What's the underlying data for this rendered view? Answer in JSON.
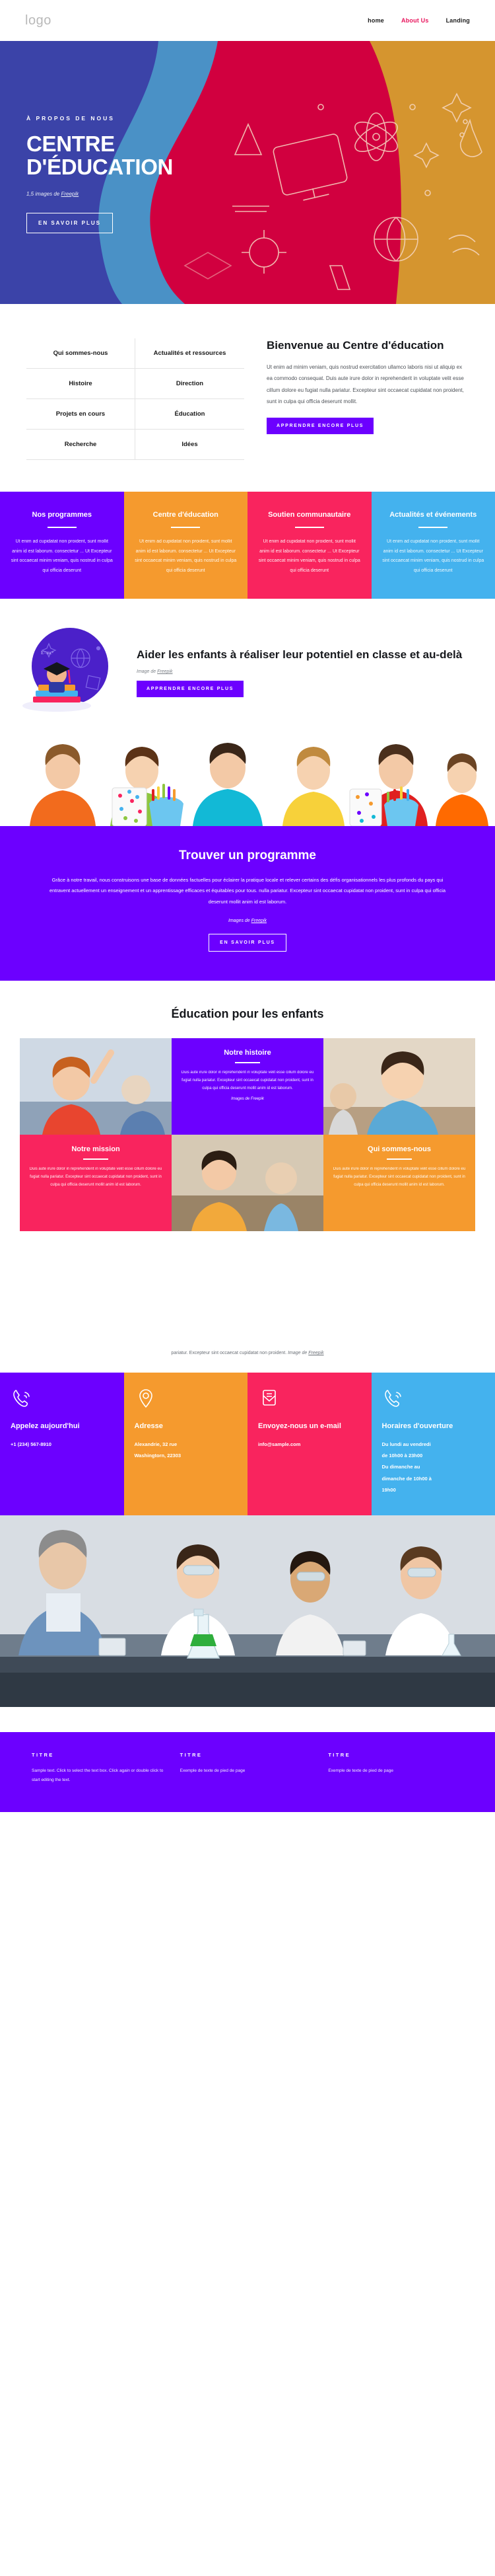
{
  "header": {
    "logo": "logo",
    "nav": [
      {
        "label": "home",
        "active": false
      },
      {
        "label": "About Us",
        "active": true
      },
      {
        "label": "Landing",
        "active": false
      }
    ]
  },
  "hero": {
    "eyebrow": "À PROPOS DE NOUS",
    "title_line1": "CENTRE",
    "title_line2": "D'ÉDUCATION",
    "credit_prefix": "1,5 images de ",
    "credit_link": "Freepik",
    "button": "EN SAVOIR PLUS",
    "colors": {
      "blue_dark": "#3b43a8",
      "blue_light": "#4a91c6",
      "crimson": "#d1003f",
      "orange": "#d5952f"
    }
  },
  "welcome": {
    "menu": [
      "Qui sommes-nous",
      "Actualités et ressources",
      "Histoire",
      "Direction",
      "Projets en cours",
      "Éducation",
      "Recherche",
      "Idées"
    ],
    "heading": "Bienvenue au Centre d'éducation",
    "paragraph": "Ut enim ad minim veniam, quis nostrud exercitation ullamco laboris nisi ut aliquip ex ea commodo consequat. Duis aute irure dolor in reprehenderit in voluptate velit esse cillum dolore eu fugiat nulla pariatur. Excepteur sint occaecat cupidatat non proident, sunt in culpa qui officia deserunt mollit.",
    "button": "APPRENDRE ENCORE PLUS"
  },
  "cards4": {
    "body": "Ut enim ad cupidatat non proident, sunt mollit anim id est laborum. consectetur ... Ut Excepteur sint occaecat minim veniam, quis nostrud in culpa qui officia deserunt",
    "items": [
      {
        "title": "Nos programmes",
        "color": "#6c00ff"
      },
      {
        "title": "Centre d'éducation",
        "color": "#f59a2e"
      },
      {
        "title": "Soutien communautaire",
        "color": "#f9245e"
      },
      {
        "title": "Actualités et événements",
        "color": "#44b2ee"
      }
    ]
  },
  "aider": {
    "heading": "Aider les enfants à réaliser leur potentiel en classe et au-delà",
    "credit_prefix": "Image de ",
    "credit_link": "Freepik",
    "button": "APPRENDRE ENCORE PLUS"
  },
  "trouver": {
    "heading": "Trouver un programme",
    "paragraph": "Grâce à notre travail, nous construisons une base de données factuelles pour éclairer la pratique locale et relever certains des défis organisationnels les plus profonds du pays qui entravent actuellement un enseignement et un apprentissage efficaces et équitables pour tous. nulla pariatur. Excepteur sint occaecat cupidatat non proident, sunt in culpa qui officia deserunt mollit anim id est laborum.",
    "credit_prefix": "Images de ",
    "credit_link": "Freepik",
    "button": "EN SAVOIR PLUS"
  },
  "education": {
    "title": "Éducation pour les enfants",
    "cards": [
      {
        "title": "Notre histoire",
        "color": "#6c00ff",
        "body": "Duis aute irure dolor in reprehenderit in voluptate velit esse cillum dolore eu fugiat nulla pariatur. Excepteur sint occaecat cupidatat non proident, sunt in culpa qui officia deserunt mollit anim id est laborum.",
        "credit": "Images de Freepik"
      },
      {
        "title": "Notre mission",
        "color": "#f9245e",
        "body": "Duis aute irure dolor in reprehenderit in voluptate velit esse cillum dolore eu fugiat nulla pariatur. Excepteur sint occaecat cupidatat non proident, sunt in culpa qui officia deserunt mollit anim id est laborum.",
        "credit": ""
      },
      {
        "title": "Qui sommes-nous",
        "color": "#f59a2e",
        "body": "Duis aute irure dolor in reprehenderit in voluptate velit esse cillum dolore eu fugiat nulla pariatur. Excepteur sint occaecat cupidatat non proident, sunt in culpa qui officia deserunt mollit anim id est laborum.",
        "credit": ""
      }
    ]
  },
  "mid_caption": {
    "text": "pariatur. Excepteur sint occaecat cupidatat non proident. ",
    "credit_prefix": "Image de ",
    "credit_link": "Freepik"
  },
  "contact": [
    {
      "icon": "phone-icon",
      "title": "Appelez aujourd'hui",
      "lines": [
        "+1 (234) 567-8910"
      ],
      "color": "#6c00ff"
    },
    {
      "icon": "map-pin-icon",
      "title": "Adresse",
      "lines": [
        "Alexandrie, 32 rue",
        "Washingtorn, 22303"
      ],
      "color": "#f59a2e"
    },
    {
      "icon": "envelope-icon",
      "title": "Envoyez-nous un e-mail",
      "lines": [
        "info@sample.com"
      ],
      "color": "#f9245e"
    },
    {
      "icon": "phone-icon",
      "title": "Horaires d'ouverture",
      "lines": [
        "Du lundi au vendredi",
        "de 10h00 à 23h00",
        "Du dimanche au",
        "dimanche de 10h00 à",
        "19h00"
      ],
      "color": "#44b2ee"
    }
  ],
  "footer": {
    "columns": [
      {
        "title": "TITRE",
        "text": "Sample text. Click to select the text box. Click again or double click to start editing the text."
      },
      {
        "title": "TITRE",
        "text": "Exemple de texte de pied de page"
      },
      {
        "title": "TITRE",
        "text": "Exemple de texte de pied de page"
      }
    ]
  }
}
